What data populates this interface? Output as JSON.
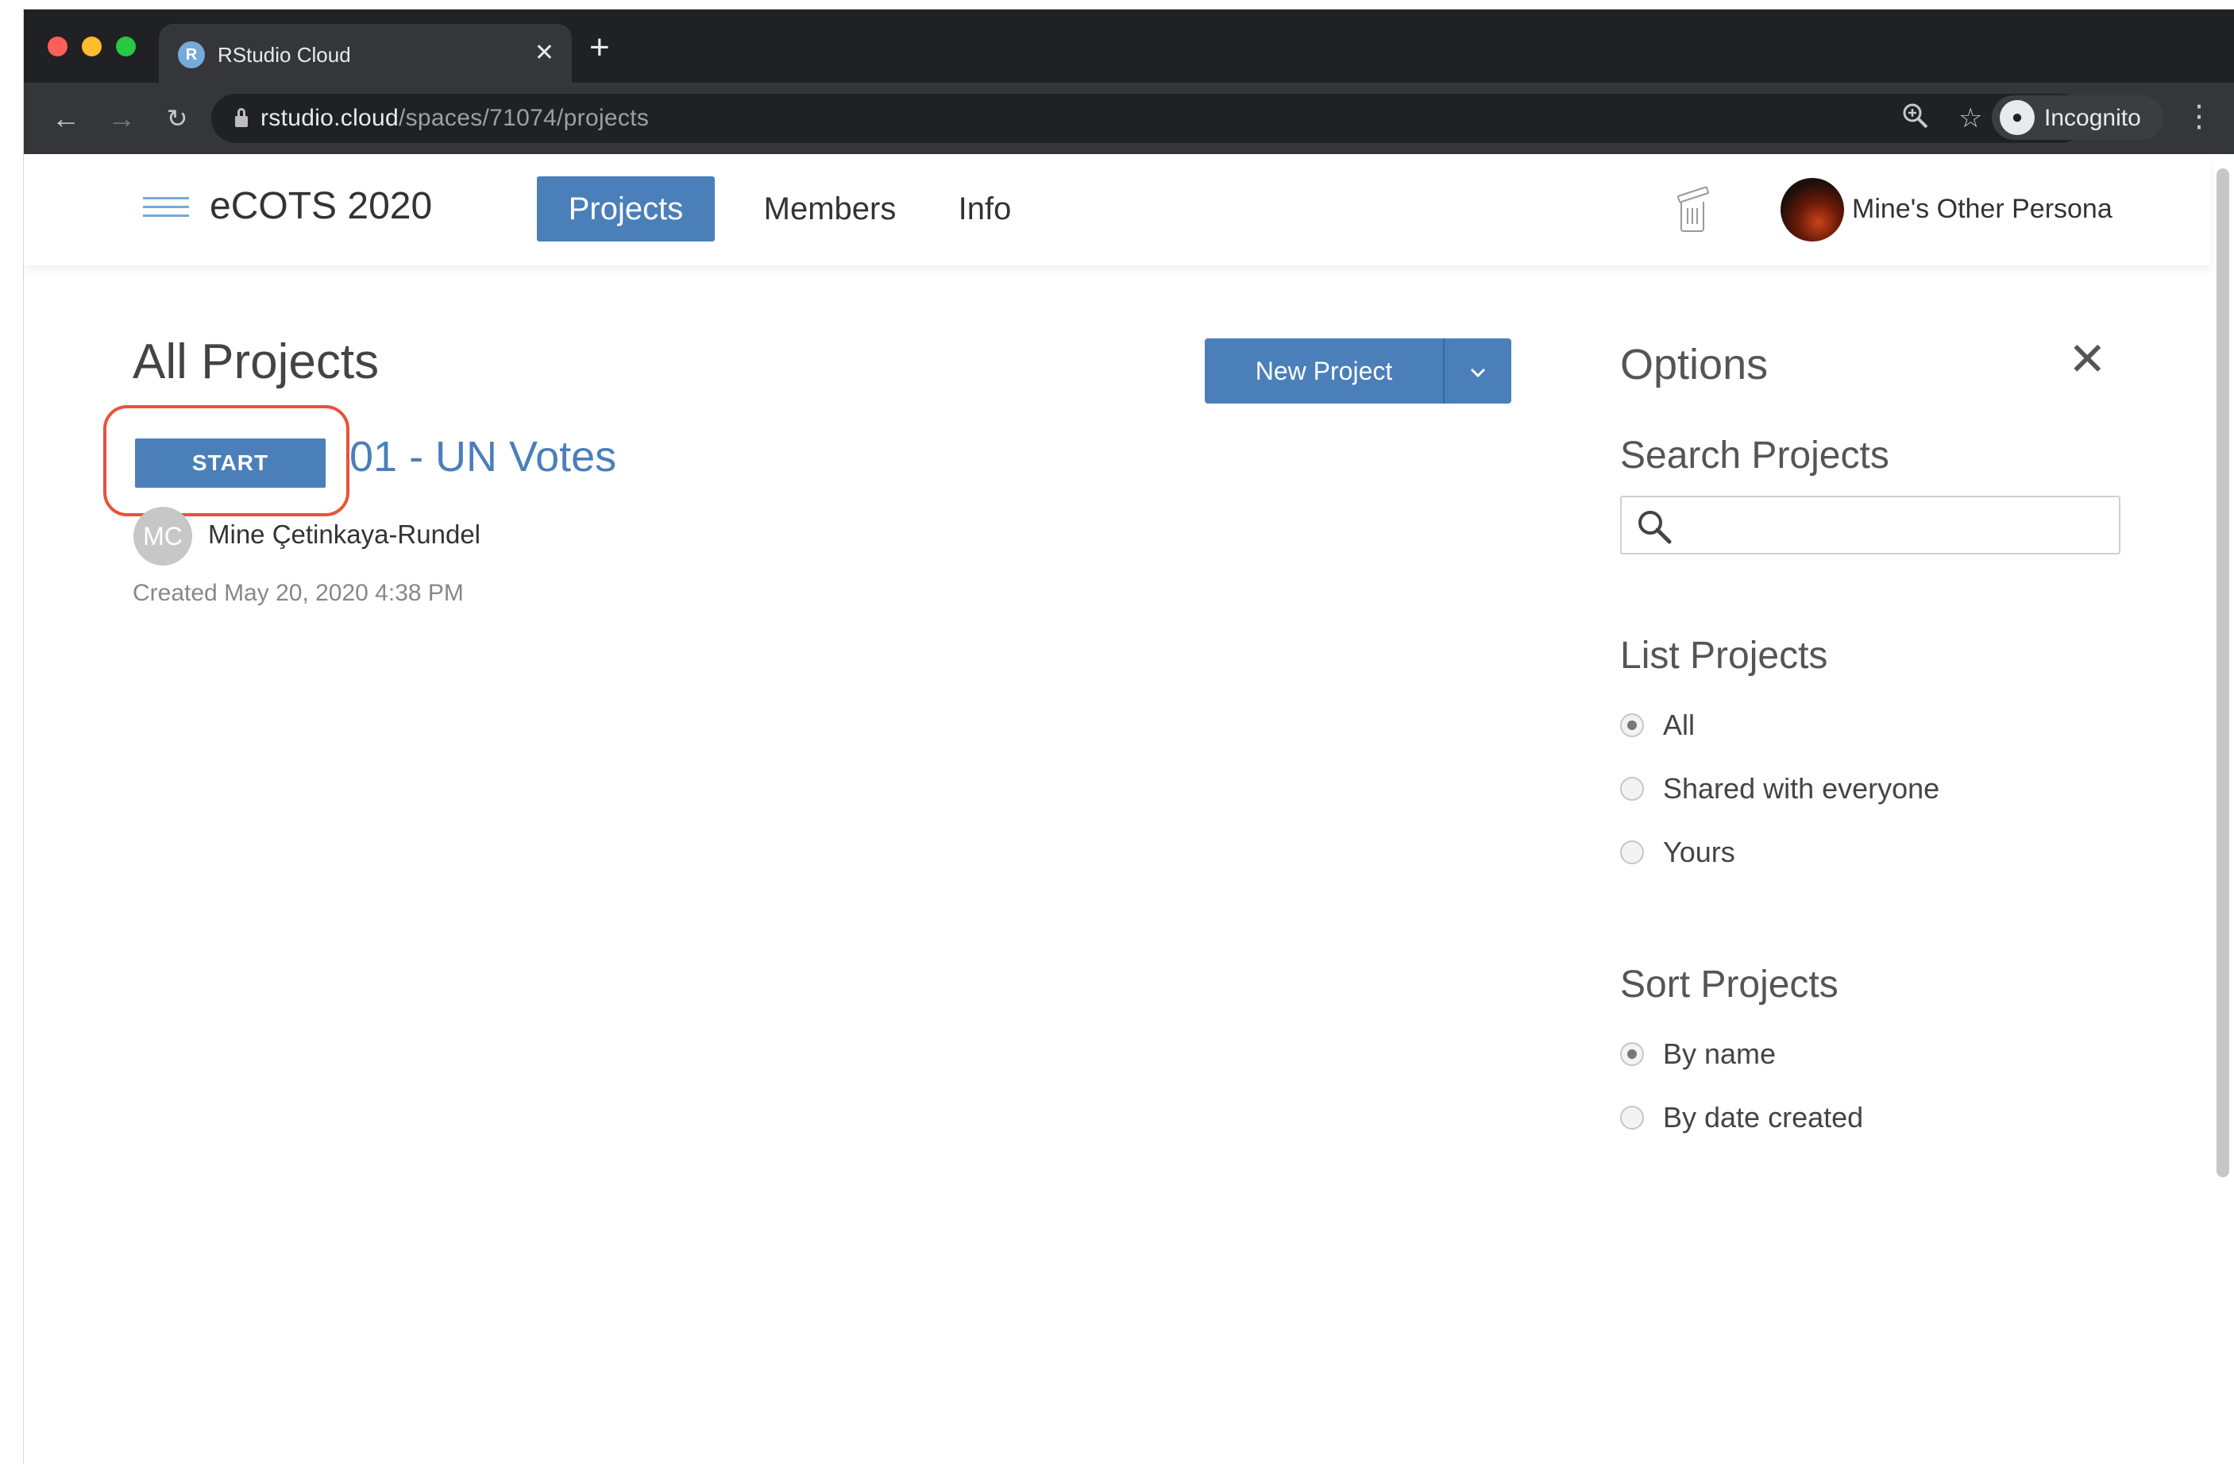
{
  "browser": {
    "tab_title": "RStudio Cloud",
    "tab_favicon_letter": "R",
    "url_host": "rstudio.cloud",
    "url_path": "/spaces/71074/projects",
    "incognito_label": "Incognito",
    "icons": [
      "back-icon",
      "forward-icon",
      "reload-icon",
      "lock-icon",
      "zoom-icon",
      "star-icon",
      "incognito-icon",
      "menu-icon",
      "close-icon",
      "plus-icon"
    ]
  },
  "header": {
    "space_name": "eCOTS 2020",
    "tabs": [
      {
        "label": "Projects",
        "active": true
      },
      {
        "label": "Members",
        "active": false
      },
      {
        "label": "Info",
        "active": false
      }
    ],
    "user_name": "Mine's Other Persona"
  },
  "main": {
    "title": "All Projects",
    "new_project_label": "New Project",
    "projects": [
      {
        "start_label": "START",
        "name": "01 - UN Votes",
        "owner_initials": "MC",
        "owner": "Mine Çetinkaya-Rundel",
        "created": "Created May 20, 2020 4:38 PM"
      }
    ]
  },
  "options": {
    "title": "Options",
    "search_label": "Search Projects",
    "search_value": "",
    "list_label": "List Projects",
    "list_options": [
      {
        "label": "All",
        "checked": true
      },
      {
        "label": "Shared with everyone",
        "checked": false
      },
      {
        "label": "Yours",
        "checked": false
      }
    ],
    "sort_label": "Sort Projects",
    "sort_options": [
      {
        "label": "By name",
        "checked": true
      },
      {
        "label": "By date created",
        "checked": false
      }
    ]
  },
  "colors": {
    "accent": "#4a7fba",
    "highlight": "#e8533a",
    "chrome_dark": "#202124"
  }
}
